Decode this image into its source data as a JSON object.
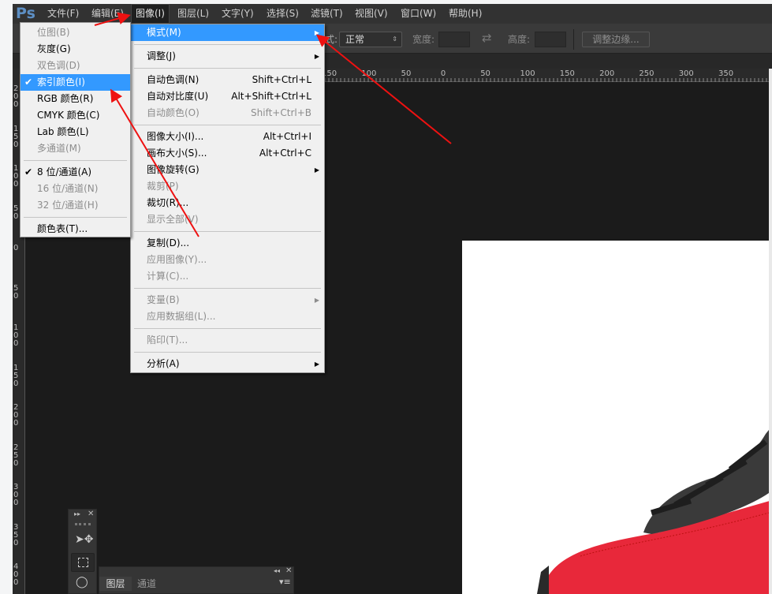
{
  "app": {
    "logo": "Ps"
  },
  "menubar": [
    {
      "label": "文件(F)"
    },
    {
      "label": "编辑(E)"
    },
    {
      "label": "图像(I)",
      "active": true
    },
    {
      "label": "图层(L)"
    },
    {
      "label": "文字(Y)"
    },
    {
      "label": "选择(S)"
    },
    {
      "label": "滤镜(T)"
    },
    {
      "label": "视图(V)"
    },
    {
      "label": "窗口(W)"
    },
    {
      "label": "帮助(H)"
    }
  ],
  "options": {
    "style_label_fragment": "式:",
    "style_value": "正常",
    "width_label": "宽度:",
    "height_label": "高度:",
    "refine_edge_button": "调整边缘..."
  },
  "rulers": {
    "horizontal": [
      "150",
      "100",
      "50",
      "0",
      "50",
      "100",
      "150",
      "200",
      "250",
      "300",
      "350"
    ],
    "vertical": [
      "200",
      "150",
      "100",
      "50",
      "0",
      "50",
      "100",
      "150",
      "200",
      "250",
      "300",
      "350",
      "400"
    ]
  },
  "image_menu": [
    {
      "label": "模式(M)",
      "submenu": true,
      "highlighted": true
    },
    {
      "separator": true
    },
    {
      "label": "调整(J)",
      "submenu": true
    },
    {
      "separator": true
    },
    {
      "label": "自动色调(N)",
      "shortcut": "Shift+Ctrl+L"
    },
    {
      "label": "自动对比度(U)",
      "shortcut": "Alt+Shift+Ctrl+L"
    },
    {
      "label": "自动颜色(O)",
      "shortcut": "Shift+Ctrl+B",
      "disabled": true
    },
    {
      "separator": true
    },
    {
      "label": "图像大小(I)...",
      "shortcut": "Alt+Ctrl+I"
    },
    {
      "label": "画布大小(S)...",
      "shortcut": "Alt+Ctrl+C"
    },
    {
      "label": "图像旋转(G)",
      "submenu": true
    },
    {
      "label": "裁剪(P)",
      "disabled": true
    },
    {
      "label": "裁切(R)..."
    },
    {
      "label": "显示全部(V)",
      "disabled": true
    },
    {
      "separator": true
    },
    {
      "label": "复制(D)..."
    },
    {
      "label": "应用图像(Y)...",
      "disabled": true
    },
    {
      "label": "计算(C)...",
      "disabled": true
    },
    {
      "separator": true
    },
    {
      "label": "变量(B)",
      "submenu": true,
      "disabled": true
    },
    {
      "label": "应用数据组(L)...",
      "disabled": true
    },
    {
      "separator": true
    },
    {
      "label": "陷印(T)...",
      "disabled": true
    },
    {
      "separator": true
    },
    {
      "label": "分析(A)",
      "submenu": true
    }
  ],
  "mode_submenu": [
    {
      "label": "位图(B)",
      "disabled": true
    },
    {
      "label": "灰度(G)"
    },
    {
      "label": "双色调(D)",
      "disabled": true
    },
    {
      "label": "索引颜色(I)",
      "checked": true,
      "highlighted": true
    },
    {
      "label": "RGB 颜色(R)"
    },
    {
      "label": "CMYK 颜色(C)"
    },
    {
      "label": "Lab 颜色(L)"
    },
    {
      "label": "多通道(M)",
      "disabled": true
    },
    {
      "separator": true
    },
    {
      "label": "8 位/通道(A)",
      "checked": true
    },
    {
      "label": "16 位/通道(N)",
      "disabled": true
    },
    {
      "label": "32 位/通道(H)",
      "disabled": true
    },
    {
      "separator": true
    },
    {
      "label": "颜色表(T)..."
    }
  ],
  "layers_panel": {
    "tabs": [
      "图层",
      "通道"
    ]
  },
  "colors": {
    "highlight": "#3399ff",
    "annotation_arrow": "#ee1111",
    "menu_bg": "#f0f0f0",
    "workspace": "#1b1b1b"
  }
}
